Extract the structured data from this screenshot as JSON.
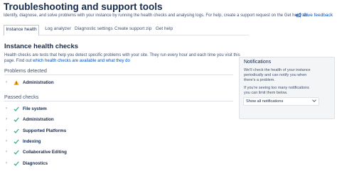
{
  "page": {
    "title": "Troubleshooting and support tools",
    "subtitle": "Identify, diagnose, and solve problems with your instance by running the health checks and analysing logs. For help, create a support request on the Get help tab.",
    "feedback": "Give feedback"
  },
  "tabs": [
    {
      "label": "Instance health",
      "active": true
    },
    {
      "label": "Log analyzer",
      "active": false
    },
    {
      "label": "Diagnostic settings",
      "active": false
    },
    {
      "label": "Create support zip",
      "active": false
    },
    {
      "label": "Get help",
      "active": false
    }
  ],
  "health": {
    "title": "Instance health checks",
    "intro_line1": "Health checks are tests that help you detect specific problems with your site. They run every hour and each time you visit this",
    "intro_line2_prefix": "page. Find out ",
    "intro_link": "which health checks are available and what they do",
    "problems_heading": "Problems detected",
    "problems": [
      {
        "label": "Administration",
        "status": "warning"
      }
    ],
    "passed_heading": "Passed checks",
    "passed": [
      {
        "label": "File system",
        "status": "ok"
      },
      {
        "label": "Administration",
        "status": "ok"
      },
      {
        "label": "Supported Platforms",
        "status": "ok"
      },
      {
        "label": "Indexing",
        "status": "ok"
      },
      {
        "label": "Collaborative Editing",
        "status": "ok"
      },
      {
        "label": "Diagnostics",
        "status": "ok"
      }
    ]
  },
  "notifications": {
    "title": "Notifications",
    "lines": [
      "We'll check the health of your instance",
      "periodically and can notify you when",
      "there's a problem.",
      "",
      "If you're seeing too many notifications",
      "you can limit them below."
    ],
    "select_value": "Show all notifications"
  },
  "colors": {
    "ok": "#36b37e",
    "warning": "#ffab00",
    "link": "#0052cc"
  }
}
